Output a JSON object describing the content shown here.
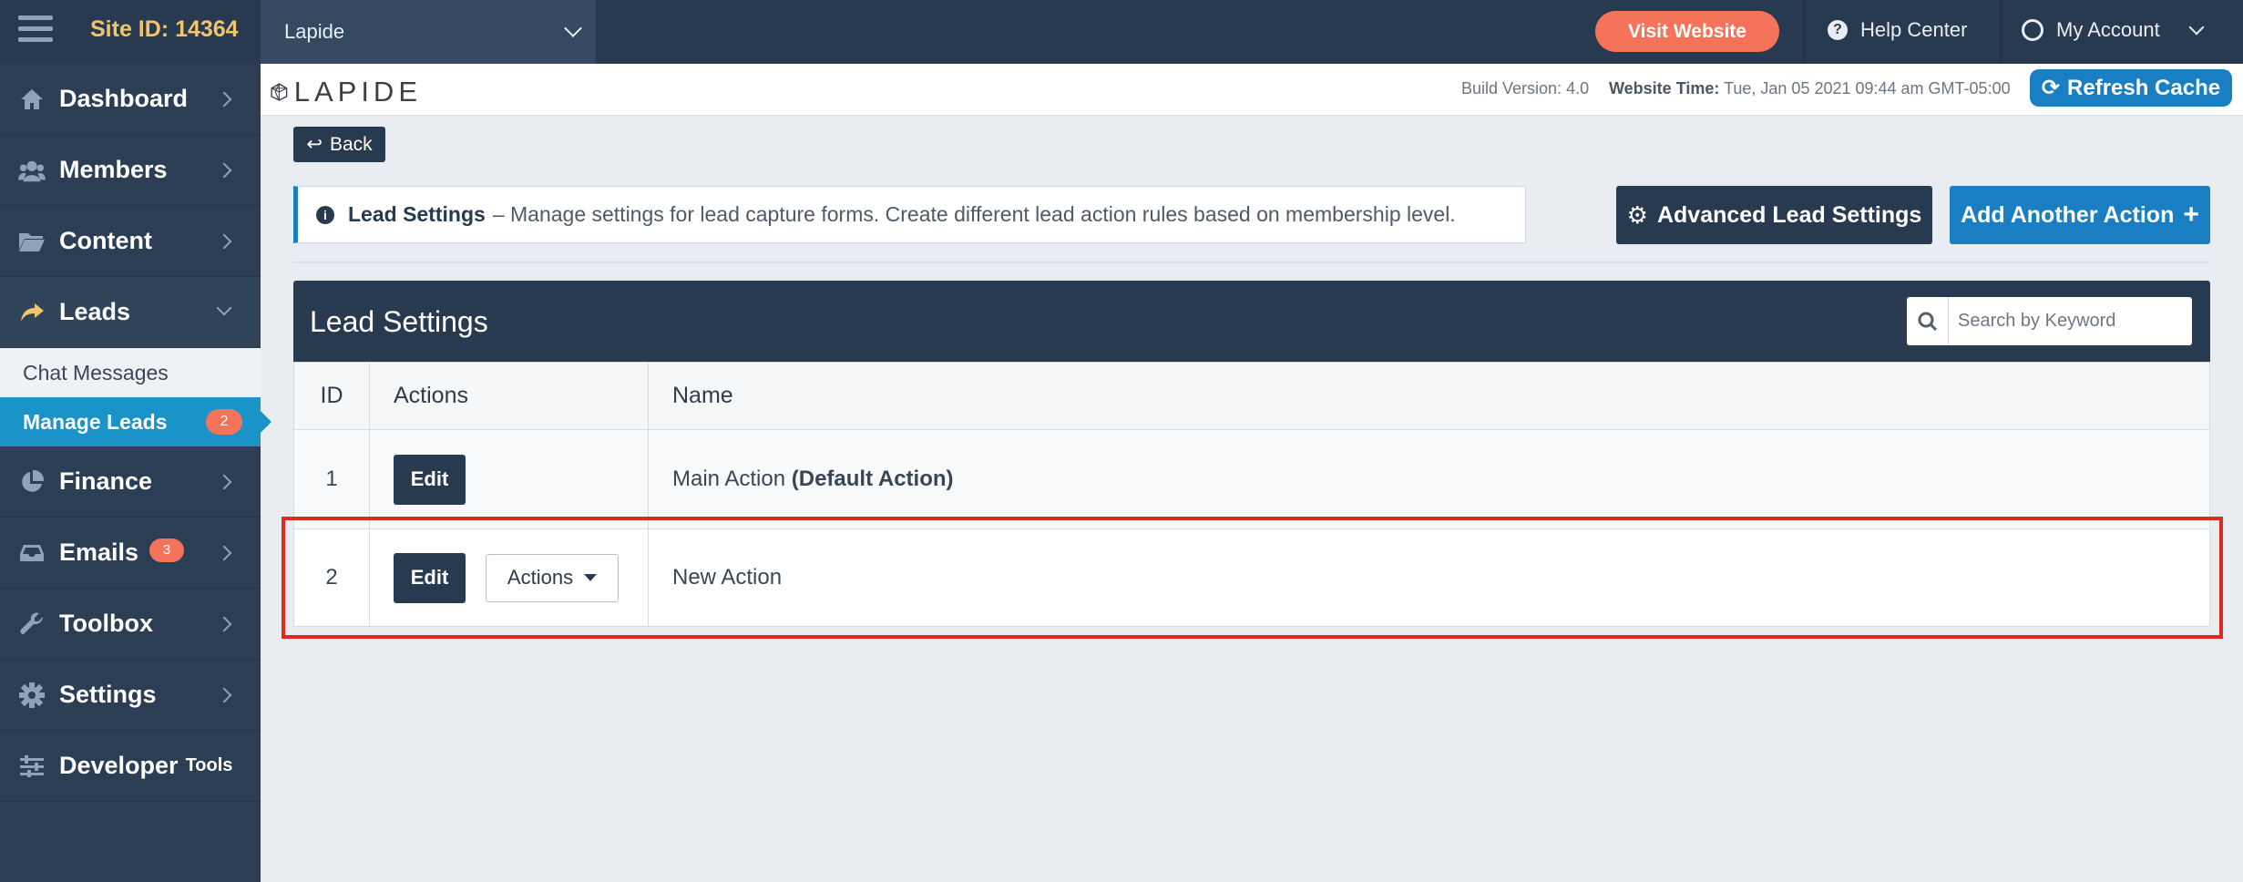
{
  "topbar": {
    "site_id": "Site ID: 14364",
    "site_select_value": "Lapide",
    "visit_website": "Visit Website",
    "help_center": "Help Center",
    "my_account": "My Account"
  },
  "sidebar": {
    "items": [
      {
        "label": "Dashboard",
        "icon": "home-icon"
      },
      {
        "label": "Members",
        "icon": "users-icon"
      },
      {
        "label": "Content",
        "icon": "folder-icon"
      },
      {
        "label": "Leads",
        "icon": "share-icon"
      },
      {
        "label": "Finance",
        "icon": "pie-chart-icon"
      },
      {
        "label": "Emails",
        "icon": "inbox-icon",
        "badge": "3"
      },
      {
        "label": "Toolbox",
        "icon": "wrench-icon"
      },
      {
        "label": "Settings",
        "icon": "gear-icon"
      },
      {
        "label": "Developer",
        "suffix": "Tools",
        "icon": "sliders-icon"
      }
    ],
    "leads_sub": [
      {
        "label": "Chat Messages"
      },
      {
        "label": "Manage Leads",
        "badge": "2",
        "active": true
      }
    ]
  },
  "header": {
    "logo_text": "LAPIDE",
    "build_version": "Build Version: 4.0",
    "website_time_label": "Website Time:",
    "website_time_value": "Tue, Jan 05 2021 09:44 am GMT-05:00",
    "refresh_cache": "Refresh Cache"
  },
  "main": {
    "back": "Back",
    "info_title": "Lead Settings",
    "info_text": "– Manage settings for lead capture forms. Create different lead action rules based on membership level.",
    "advanced_btn": "Advanced Lead Settings",
    "add_btn": "Add Another Action",
    "panel_title": "Lead Settings",
    "search_placeholder": "Search by Keyword",
    "columns": [
      "ID",
      "Actions",
      "Name"
    ],
    "rows": [
      {
        "id": "1",
        "edit": "Edit",
        "name": "Main Action",
        "name_suffix": "(Default Action)"
      },
      {
        "id": "2",
        "edit": "Edit",
        "actions": "Actions",
        "name": "New Action"
      }
    ]
  },
  "colors": {
    "navy": "#283a4f",
    "accent_blue": "#1a7fc2",
    "coral": "#f5735a",
    "highlight_red": "#e0281d"
  }
}
